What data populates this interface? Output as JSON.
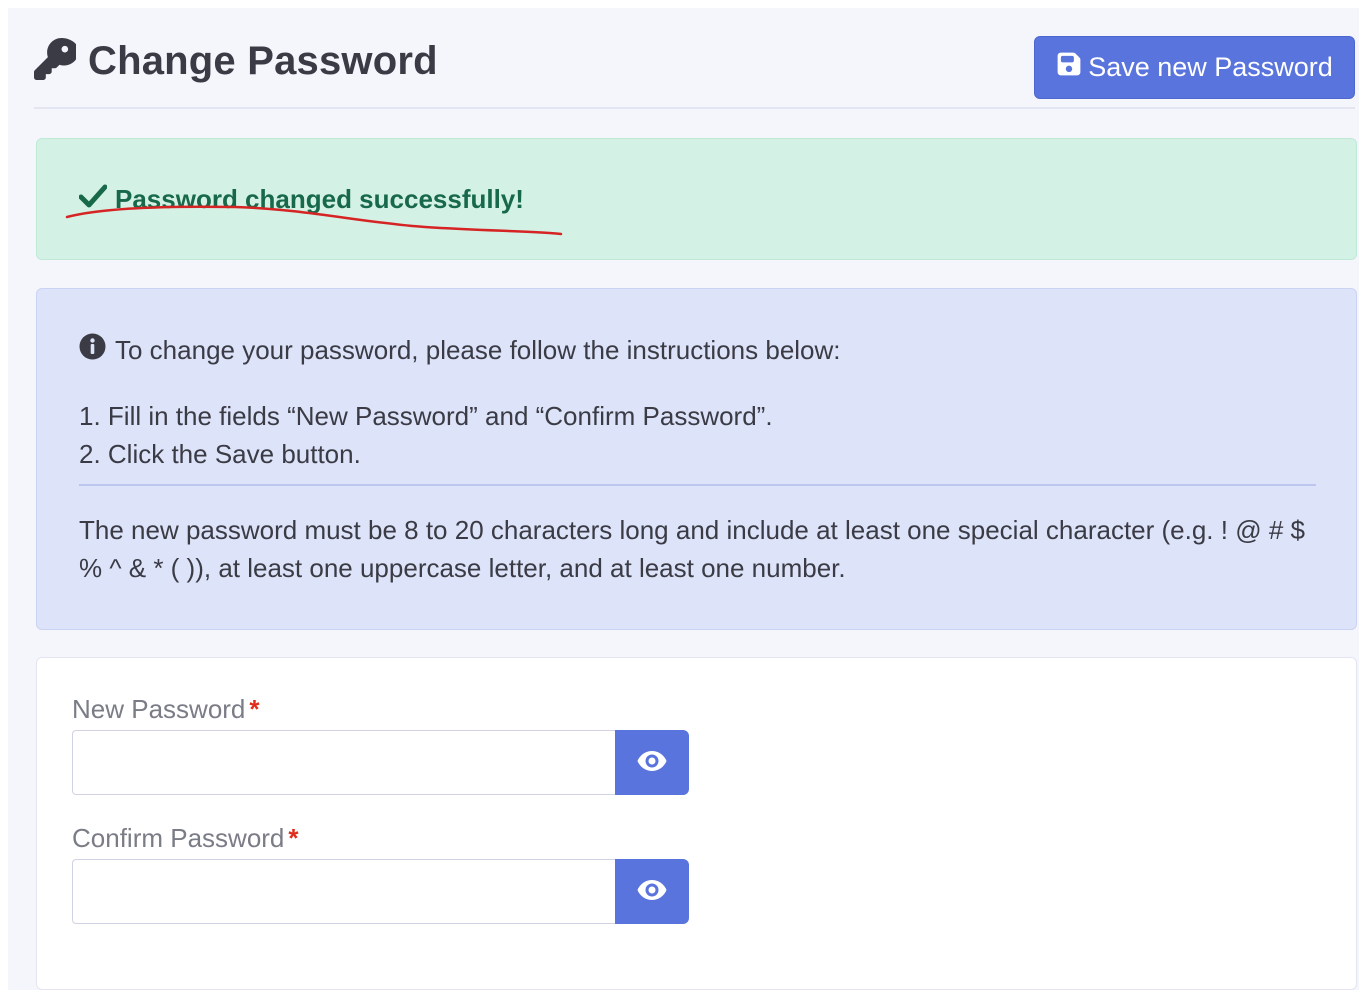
{
  "header": {
    "title": "Change Password",
    "save_label": "Save new Password"
  },
  "success_alert": {
    "message": "Password changed successfully!"
  },
  "info_alert": {
    "heading": "To change your password, please follow the instructions below:",
    "steps": [
      "1. Fill in the fields “New Password” and “Confirm Password”.",
      "2. Click the Save button."
    ],
    "rules": "The new password must be 8 to 20 characters long and include at least one special character (e.g. ! @ # $ % ^ & * ( )), at least one uppercase letter, and at least one number."
  },
  "form": {
    "new_password": {
      "label": "New Password",
      "required_mark": "*",
      "value": ""
    },
    "confirm_password": {
      "label": "Confirm Password",
      "required_mark": "*",
      "value": ""
    }
  },
  "icons": {
    "title_icon": "key-icon",
    "save_icon": "floppy-disk-icon",
    "success_icon": "checkmark-icon",
    "info_icon": "info-circle-icon",
    "toggle_icon": "eye-icon"
  },
  "colors": {
    "accent": "#5a74dd",
    "success_bg": "#d3f2e5",
    "success_text": "#17694a",
    "info_bg": "#dde3f8",
    "required": "#e02d1b",
    "annotation": "#d62424"
  }
}
